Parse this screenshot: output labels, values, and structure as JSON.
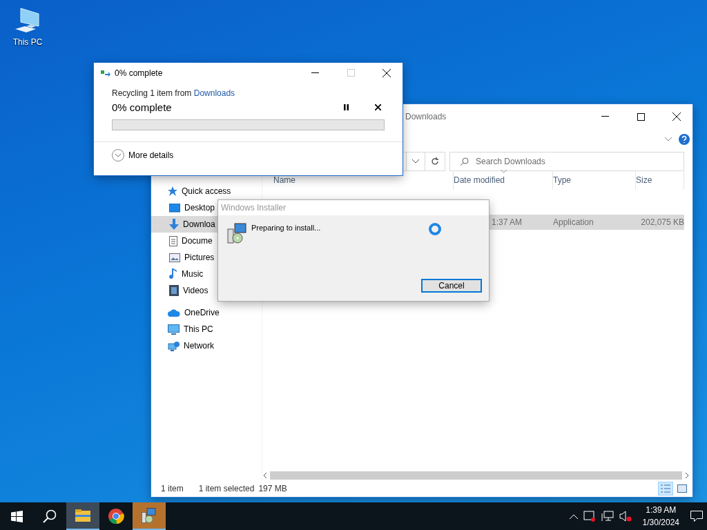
{
  "desktop_icons": [
    {
      "label": "This PC"
    }
  ],
  "explorer": {
    "title": "Downloads",
    "search": {
      "placeholder": "Search Downloads"
    },
    "nav": [
      {
        "label": "Quick access",
        "kind": "star",
        "selected": false,
        "children": [
          {
            "label": "Desktop",
            "kind": "desktop",
            "selected": false
          },
          {
            "label": "Downloa",
            "kind": "download",
            "selected": true
          },
          {
            "label": "Docume",
            "kind": "document",
            "selected": false
          },
          {
            "label": "Pictures",
            "kind": "pictures",
            "selected": false
          },
          {
            "label": "Music",
            "kind": "music",
            "selected": false
          },
          {
            "label": "Videos",
            "kind": "videos",
            "selected": false
          }
        ]
      },
      {
        "label": "OneDrive",
        "kind": "cloud",
        "selected": false
      },
      {
        "label": "This PC",
        "kind": "pc",
        "selected": false
      },
      {
        "label": "Network",
        "kind": "network",
        "selected": false
      }
    ],
    "columns": [
      "Name",
      "Date modified",
      "Type",
      "Size"
    ],
    "rows": [
      {
        "date": "1:37 AM",
        "type": "Application",
        "size": "202,075 KB",
        "selected": true
      }
    ],
    "status_bar": {
      "count": "1 item",
      "selection": "1 item selected",
      "size": "197 MB"
    },
    "view_buttons": [
      {
        "kind": "details",
        "selected": true
      },
      {
        "kind": "large_icons",
        "selected": false
      }
    ]
  },
  "progress_dialog": {
    "title": "0% complete",
    "message": "Recycling 1 item from",
    "source_link": "Downloads",
    "status": "0% complete",
    "progress": {
      "level": 0
    },
    "more_details": "More details"
  },
  "installer": {
    "title": "Windows Installer",
    "active": false,
    "message": "Preparing to install...",
    "buttons": [
      {
        "label": "Cancel",
        "default": true
      }
    ]
  },
  "taskbar": {
    "apps": [
      {
        "kind": "explorer",
        "active": true,
        "flashing": false
      },
      {
        "kind": "chrome",
        "active": false,
        "flashing": false
      },
      {
        "kind": "installer",
        "active": false,
        "flashing": true
      }
    ],
    "clock": {
      "time": "1:39 AM",
      "date": "1/30/2024"
    }
  }
}
